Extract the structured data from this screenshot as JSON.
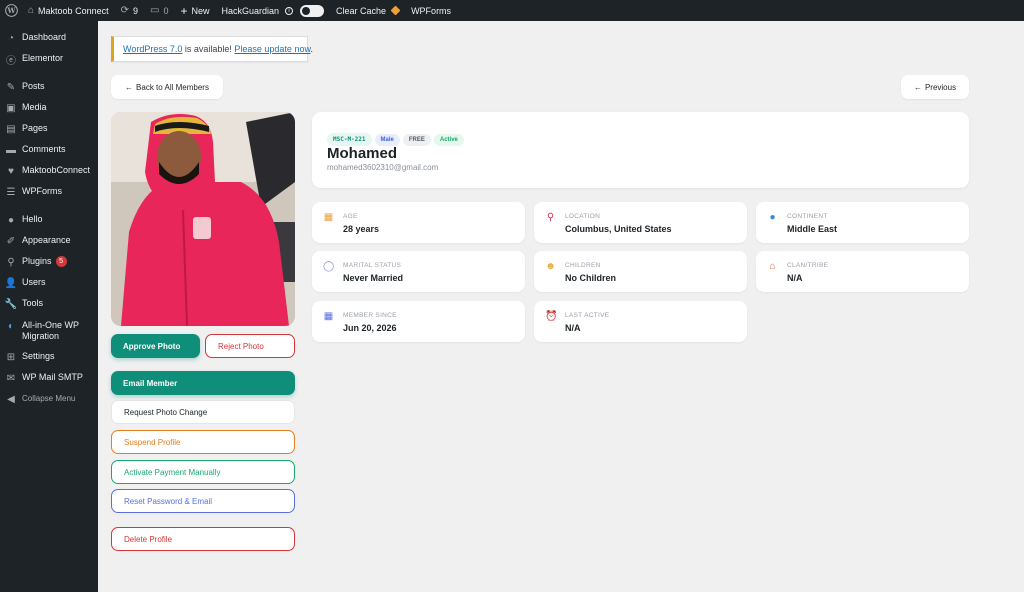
{
  "adminbar": {
    "site_name": "Maktoob Connect",
    "updates_count": "9",
    "comments_count": "0",
    "new_label": "New",
    "hackguardian_label": "HackGuardian",
    "clear_cache_label": "Clear Cache",
    "wpforms_label": "WPForms"
  },
  "sidebar": {
    "items": [
      {
        "label": "Dashboard",
        "icon": "dashboard-icon"
      },
      {
        "label": "Elementor",
        "icon": "elementor-icon"
      },
      {
        "label": "Posts",
        "icon": "pin-icon"
      },
      {
        "label": "Media",
        "icon": "media-icon"
      },
      {
        "label": "Pages",
        "icon": "pages-icon"
      },
      {
        "label": "Comments",
        "icon": "comments-icon"
      },
      {
        "label": "MaktoobConnect",
        "icon": "heart-icon"
      },
      {
        "label": "WPForms",
        "icon": "forms-icon"
      },
      {
        "label": "Hello",
        "icon": "hello-icon"
      },
      {
        "label": "Appearance",
        "icon": "brush-icon"
      },
      {
        "label": "Plugins",
        "icon": "plug-icon",
        "badge": "5"
      },
      {
        "label": "Users",
        "icon": "users-icon"
      },
      {
        "label": "Tools",
        "icon": "wrench-icon"
      },
      {
        "label": "All-in-One WP Migration",
        "icon": "migration-icon"
      },
      {
        "label": "Settings",
        "icon": "settings-icon"
      },
      {
        "label": "WP Mail SMTP",
        "icon": "mail-icon"
      }
    ],
    "collapse_label": "Collapse Menu"
  },
  "notice": {
    "link1": "WordPress 7.0",
    "middle": " is available! ",
    "link2": "Please update now",
    "end": "."
  },
  "nav": {
    "back_label": "Back to All Members",
    "previous_label": "Previous"
  },
  "actions": {
    "approve_photo": "Approve Photo",
    "reject_photo": "Reject Photo",
    "email_member": "Email Member",
    "request_photo_change": "Request Photo Change",
    "suspend_profile": "Suspend Profile",
    "activate_payment": "Activate Payment Manually",
    "reset_password": "Reset Password & Email",
    "delete_profile": "Delete Profile"
  },
  "profile": {
    "id_tag": "MSC-M-221",
    "gender_tag": "Male",
    "plan_tag": "FREE",
    "status_tag": "Active",
    "name": "Mohamed",
    "email": "mohamed3602310@gmail.com"
  },
  "info": [
    {
      "label": "Age",
      "value": "28 years",
      "icon": "cake-icon"
    },
    {
      "label": "Location",
      "value": "Columbus, United States",
      "icon": "pin-icon"
    },
    {
      "label": "Continent",
      "value": "Middle East",
      "icon": "globe-icon"
    },
    {
      "label": "Marital Status",
      "value": "Never Married",
      "icon": "ring-icon"
    },
    {
      "label": "Children",
      "value": "No Children",
      "icon": "child-icon"
    },
    {
      "label": "Clan/Tribe",
      "value": "N/A",
      "icon": "house-icon"
    },
    {
      "label": "Member Since",
      "value": "Jun 20, 2026",
      "icon": "calendar-icon"
    },
    {
      "label": "Last Active",
      "value": "N/A",
      "icon": "clock-icon"
    }
  ],
  "colors": {
    "teal": "#0f8f7a",
    "red": "#d63638",
    "orange": "#e67e22",
    "green": "#1aa870",
    "violet": "#5b6ee1"
  }
}
